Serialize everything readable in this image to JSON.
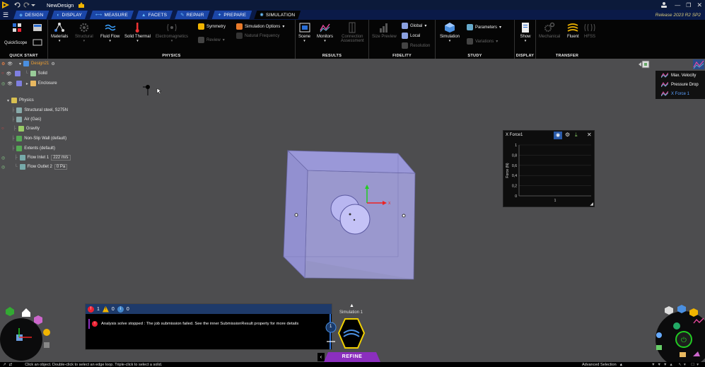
{
  "window": {
    "title": "NewDesign",
    "release": "Release 2023 R2 SP2"
  },
  "tabs": [
    {
      "label": "Design",
      "icon": "design-icon"
    },
    {
      "label": "Display",
      "icon": "display-icon"
    },
    {
      "label": "Measure",
      "icon": "measure-icon"
    },
    {
      "label": "Facets",
      "icon": "facets-icon"
    },
    {
      "label": "Repair",
      "icon": "repair-icon"
    },
    {
      "label": "Prepare",
      "icon": "prepare-icon"
    },
    {
      "label": "Simulation",
      "icon": "simulation-icon",
      "active": true
    }
  ],
  "ribbon": {
    "quick_start": {
      "label": "Quick Start",
      "quickscope": "QuickScope"
    },
    "physics": {
      "label": "Physics",
      "materials": "Materials",
      "structural": "Structural",
      "fluid_flow": "Fluid Flow",
      "solid_thermal": "Solid Thermal",
      "electromagnetics": "Electromagnetics",
      "symmetry": "Symmetry",
      "review": "Review",
      "simulation_options": "Simulation Options",
      "natural_frequency": "Natural Frequency"
    },
    "results": {
      "label": "Results",
      "scene": "Scene",
      "monitors": "Monitors",
      "connection_assessment_1": "Connection",
      "connection_assessment_2": "Assessment"
    },
    "fidelity": {
      "label": "Fidelity",
      "size_preview": "Size Preview",
      "global": "Global",
      "local": "Local",
      "resolution": "Resolution"
    },
    "study": {
      "label": "Study",
      "simulation": "Simulation",
      "parameters": "Parameters",
      "variations": "Variations"
    },
    "display": {
      "label": "Display",
      "show": "Show"
    },
    "transfer": {
      "label": "Transfer",
      "mechanical": "Mechanical",
      "fluent": "Fluent",
      "hfss": "HFSS"
    }
  },
  "tree": {
    "design": "Design21",
    "solid": "Solid",
    "enclosure": "Enclosure",
    "physics": "Physics",
    "structural_steel": "Structural steel, S275N",
    "air": "Air (Gas)",
    "gravity": "Gravity",
    "non_slip_wall": "Non-Slip Wall (default)",
    "extents": "Extents (default)",
    "flow_inlet": "Flow Inlet 1",
    "flow_inlet_value": "222 m/s",
    "flow_outlet": "Flow Outlet 2",
    "flow_outlet_value": "0 Pa"
  },
  "legend": {
    "items": [
      {
        "label": "Max. Velocity",
        "active": false
      },
      {
        "label": "Pressure Drop",
        "active": false
      },
      {
        "label": "X Force 1",
        "active": true
      }
    ]
  },
  "chart_data": {
    "type": "line",
    "title": "X Force1",
    "ylabel": "Force (N)",
    "xlabel": "",
    "y_ticks": [
      "1",
      "0,8",
      "0,6",
      "0,4",
      "0,2",
      "0"
    ],
    "x_ticks": [
      "1"
    ],
    "ylim": [
      0,
      1
    ],
    "series": []
  },
  "messages": {
    "error_count": "1",
    "warning_count": "0",
    "info_count": "0",
    "text": "Analysis solve stopped : The job submission failed. See the inner SubmissionResult property for more details"
  },
  "simulation_badge": {
    "label": "Simulation 1",
    "count": "1"
  },
  "refine": "Refine",
  "status": {
    "hint": "Click an object. Double-click to select an edge loop. Triple-click to select a solid.",
    "advanced_selection": "Advanced Selection"
  },
  "colors": {
    "tab_blue": "#1b46a8",
    "ribbon_bg": "#050505",
    "viewport_bg": "#4d4d4f",
    "refine_purple": "#8b2fbe",
    "release_text": "#d8c97a"
  }
}
